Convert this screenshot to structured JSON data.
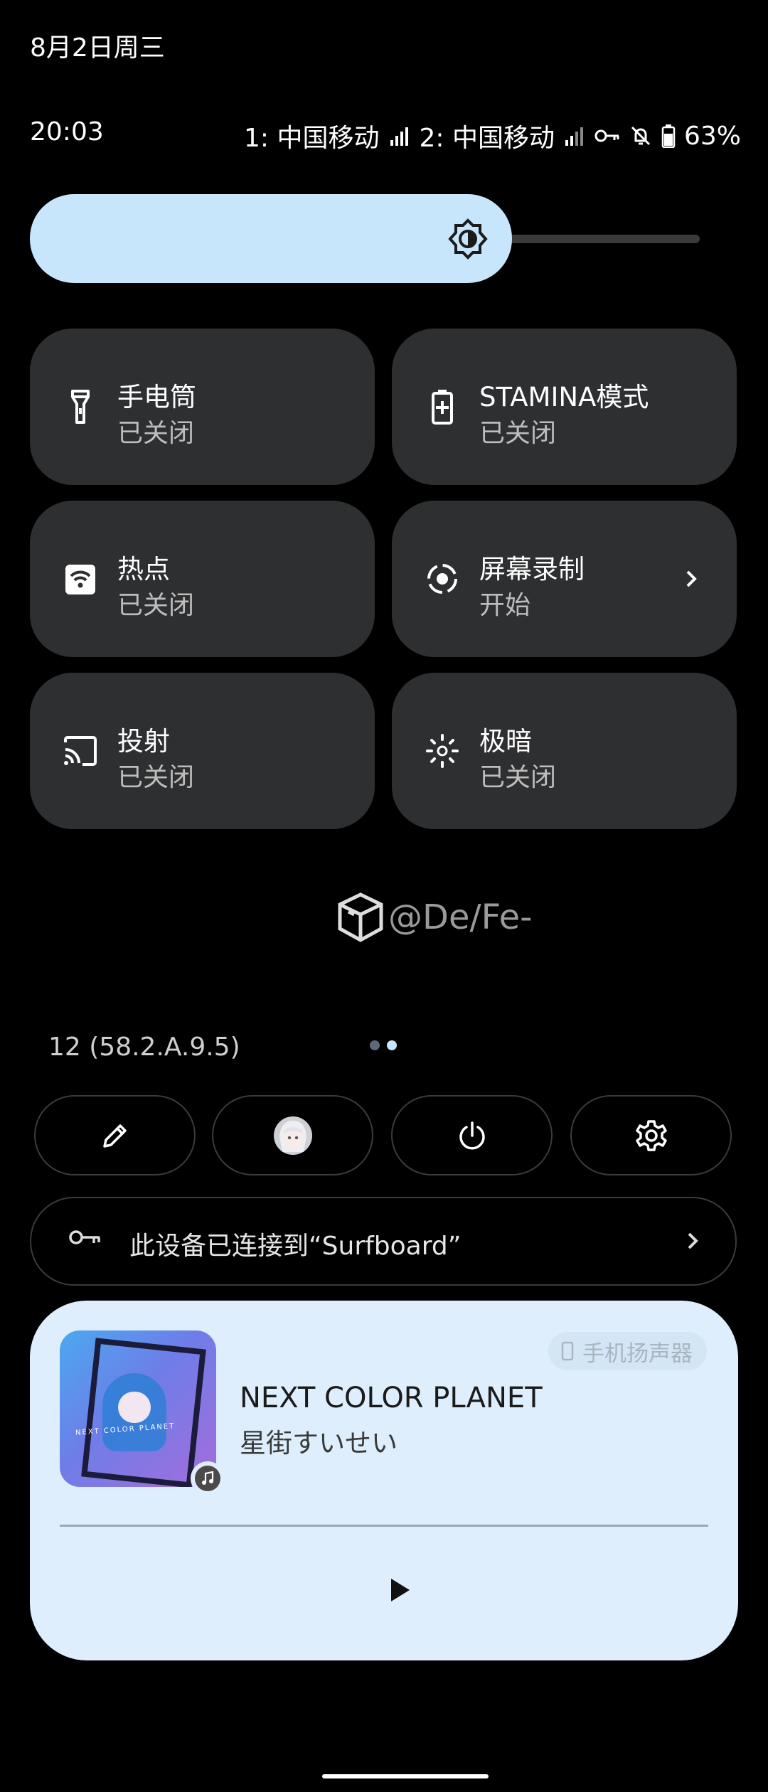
{
  "status": {
    "date": "8月2日周三",
    "time": "20:03",
    "sim1": "1: 中国移动",
    "sim2": "2: 中国移动",
    "battery": "63%"
  },
  "brightness": {
    "level_fraction": 0.72,
    "icon": "brightness-icon"
  },
  "tiles": [
    {
      "title": "手电筒",
      "sub": "已关闭",
      "icon": "flashlight-icon"
    },
    {
      "title": "STAMINA模式",
      "sub": "已关闭",
      "icon": "battery-saver-icon"
    },
    {
      "title": "热点",
      "sub": "已关闭",
      "icon": "hotspot-icon"
    },
    {
      "title": "屏幕录制",
      "sub": "开始",
      "icon": "screen-record-icon"
    },
    {
      "title": "投射",
      "sub": "已关闭",
      "icon": "cast-icon"
    },
    {
      "title": "极暗",
      "sub": "已关闭",
      "icon": "extra-dim-icon"
    }
  ],
  "watermark": {
    "text": "@De/Fe-"
  },
  "build": "12 (58.2.A.9.5)",
  "page_indicator": {
    "total": 2,
    "current": 2
  },
  "vpn": {
    "text": "此设备已连接到“Surfboard”"
  },
  "media": {
    "device": "手机扬声器",
    "song": "NEXT COLOR PLANET",
    "artist": "星街すいせい",
    "art_text": "NEXT COLOR PLANET"
  },
  "colors": {
    "accent": "#c7e5fb",
    "tile": "#2e2f31",
    "media_bg": "#deeefc"
  }
}
